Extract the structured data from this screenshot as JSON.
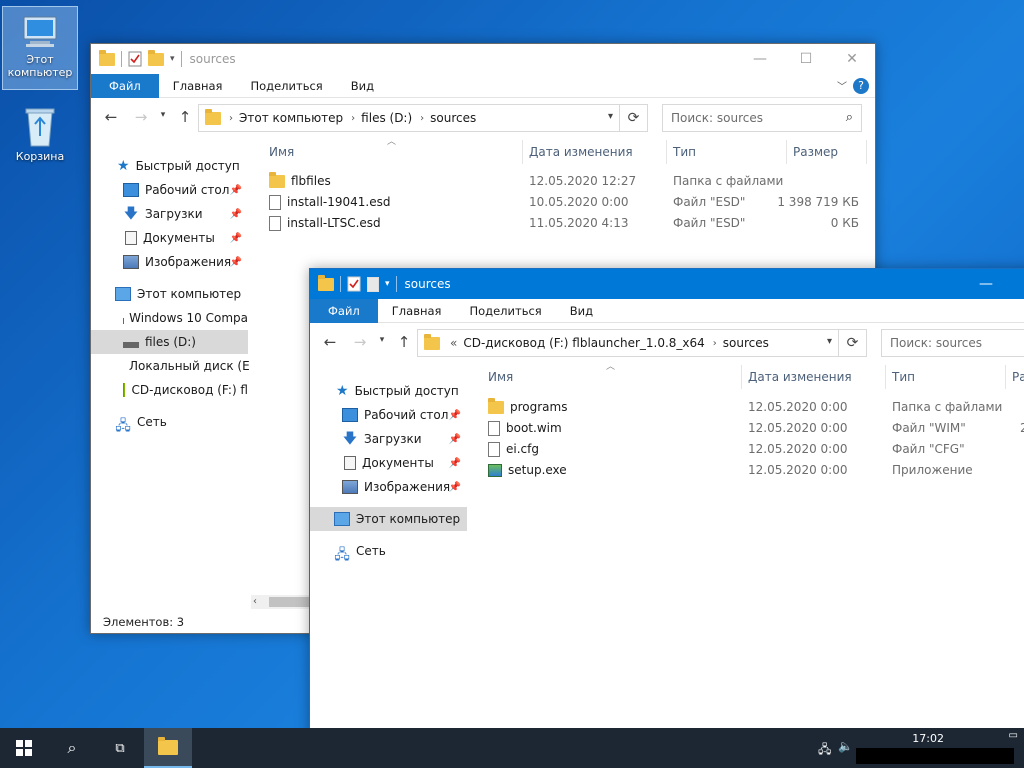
{
  "desktop": {
    "icons": [
      {
        "label": "Этот компьютер",
        "selected": true
      },
      {
        "label": "Корзина",
        "selected": false
      }
    ]
  },
  "win_back": {
    "title": "sources",
    "ribbon": [
      "Файл",
      "Главная",
      "Поделиться",
      "Вид"
    ],
    "address": [
      "Этот компьютер",
      "files (D:)",
      "sources"
    ],
    "search_placeholder": "Поиск: sources",
    "nav": [
      {
        "label": "Быстрый доступ",
        "icon": "star-icon"
      },
      {
        "label": "Рабочий стол",
        "icon": "desktop-icon",
        "pinned": true
      },
      {
        "label": "Загрузки",
        "icon": "download-icon",
        "pinned": true
      },
      {
        "label": "Документы",
        "icon": "documents-icon",
        "pinned": true
      },
      {
        "label": "Изображения",
        "icon": "pictures-icon",
        "pinned": true
      },
      {
        "label": "Этот компьютер",
        "icon": "computer-icon"
      },
      {
        "label": "Windows 10 Compa",
        "icon": "drive-icon"
      },
      {
        "label": "files (D:)",
        "icon": "drive-icon",
        "selected": true
      },
      {
        "label": "Локальный диск (E",
        "icon": "drive-icon"
      },
      {
        "label": "CD-дисковод (F:) fl",
        "icon": "windows-drive-icon"
      },
      {
        "label": "Сеть",
        "icon": "network-icon"
      }
    ],
    "columns": [
      "Имя",
      "Дата изменения",
      "Тип",
      "Размер"
    ],
    "files": [
      {
        "name": "flbfiles",
        "date": "12.05.2020 12:27",
        "type": "Папка с файлами",
        "size": "",
        "icon": "folder-icon"
      },
      {
        "name": "install-19041.esd",
        "date": "10.05.2020 0:00",
        "type": "Файл \"ESD\"",
        "size": "1 398 719 КБ",
        "icon": "file-icon"
      },
      {
        "name": "install-LTSC.esd",
        "date": "11.05.2020 4:13",
        "type": "Файл \"ESD\"",
        "size": "0 КБ",
        "icon": "file-icon"
      }
    ],
    "status": "Элементов: 3"
  },
  "win_front": {
    "title": "sources",
    "ribbon": [
      "Файл",
      "Главная",
      "Поделиться",
      "Вид"
    ],
    "address": [
      "«",
      "CD-дисковод (F:) flblauncher_1.0.8_x64",
      "sources"
    ],
    "search_placeholder": "Поиск: sources",
    "nav": [
      {
        "label": "Быстрый доступ",
        "icon": "star-icon"
      },
      {
        "label": "Рабочий стол",
        "icon": "desktop-icon",
        "pinned": true
      },
      {
        "label": "Загрузки",
        "icon": "download-icon",
        "pinned": true
      },
      {
        "label": "Документы",
        "icon": "documents-icon",
        "pinned": true
      },
      {
        "label": "Изображения",
        "icon": "pictures-icon",
        "pinned": true
      },
      {
        "label": "Этот компьютер",
        "icon": "computer-icon",
        "selected": true
      },
      {
        "label": "Сеть",
        "icon": "network-icon"
      }
    ],
    "columns": [
      "Имя",
      "Дата изменения",
      "Тип",
      "Ра"
    ],
    "files": [
      {
        "name": "programs",
        "date": "12.05.2020 0:00",
        "type": "Папка с файлами",
        "size": "",
        "icon": "folder-icon"
      },
      {
        "name": "boot.wim",
        "date": "12.05.2020 0:00",
        "type": "Файл \"WIM\"",
        "size": "2",
        "icon": "file-icon"
      },
      {
        "name": "ei.cfg",
        "date": "12.05.2020 0:00",
        "type": "Файл \"CFG\"",
        "size": "",
        "icon": "file-icon"
      },
      {
        "name": "setup.exe",
        "date": "12.05.2020 0:00",
        "type": "Приложение",
        "size": "",
        "icon": "setup-exe-icon"
      }
    ]
  },
  "taskbar": {
    "clock": "17:02"
  }
}
